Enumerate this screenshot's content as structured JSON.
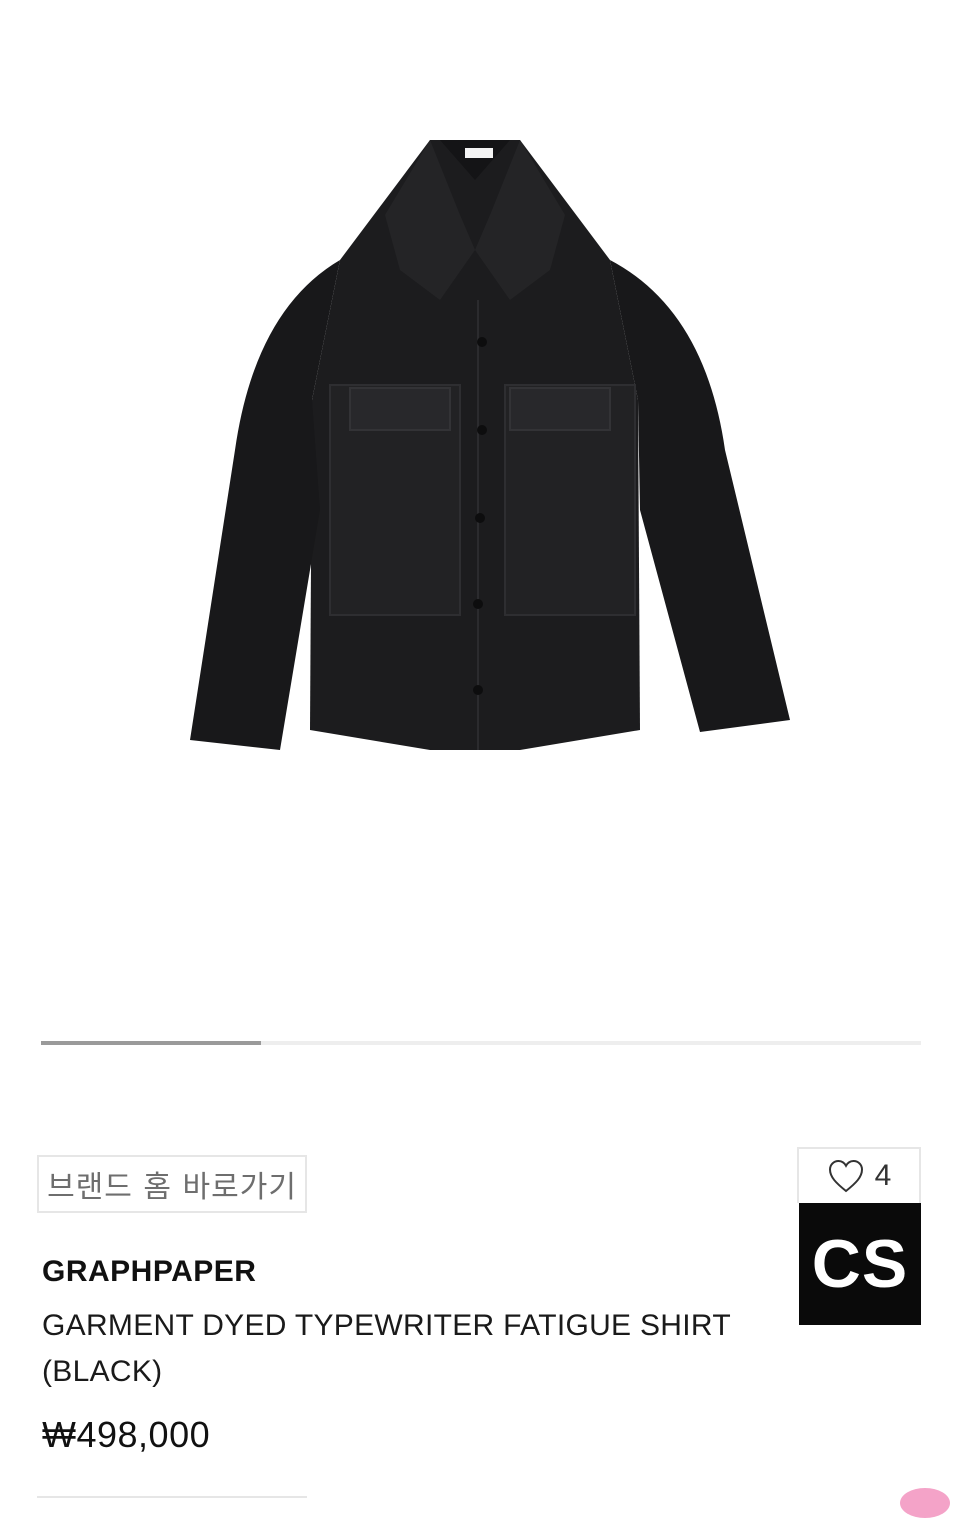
{
  "product_image": {
    "alt": "black fatigue shirt",
    "garment_color": "#1c1c1e"
  },
  "carousel": {
    "progress": 0.25,
    "track_color": "#eeeeee",
    "progress_color": "#9a9a9a"
  },
  "brand_home_button": {
    "label": "브랜드 홈 바로가기"
  },
  "like": {
    "icon": "heart-outline-icon",
    "count": "4"
  },
  "badge": {
    "label": "CS"
  },
  "product": {
    "brand": "GRAPHPAPER",
    "name": "GARMENT DYED TYPEWRITER FATIGUE SHIRT (BLACK)",
    "price": "₩498,000"
  }
}
